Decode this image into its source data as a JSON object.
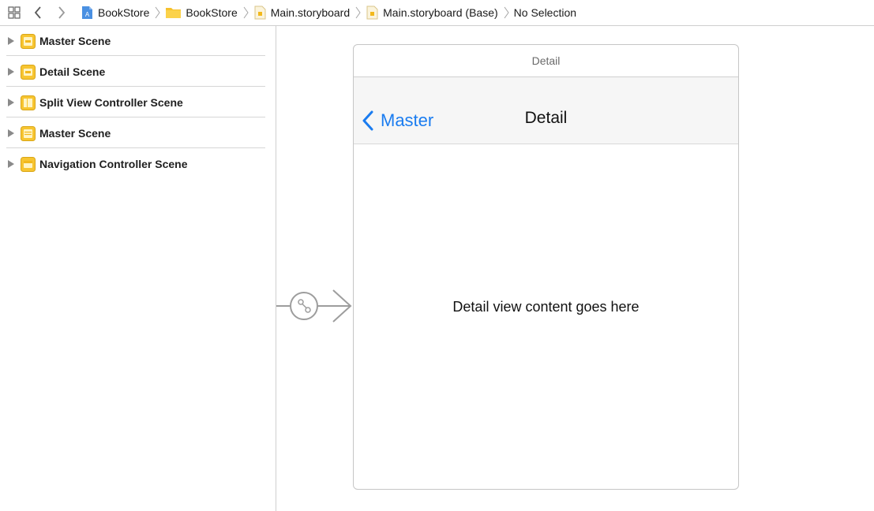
{
  "toolbar": {
    "icons": [
      "grid-icon",
      "back-arrow-icon",
      "forward-arrow-icon"
    ]
  },
  "breadcrumb": [
    {
      "label": "BookStore",
      "icon": "project-icon"
    },
    {
      "label": "BookStore",
      "icon": "folder-icon"
    },
    {
      "label": "Main.storyboard",
      "icon": "storyboard-file-icon"
    },
    {
      "label": "Main.storyboard (Base)",
      "icon": "storyboard-file-icon"
    },
    {
      "label": "No Selection",
      "icon": ""
    }
  ],
  "outline": {
    "scenes": [
      {
        "label": "Master Scene",
        "icon": "table-view-controller-icon"
      },
      {
        "label": "Detail Scene",
        "icon": "view-controller-icon"
      },
      {
        "label": "Split View Controller Scene",
        "icon": "split-view-controller-icon"
      },
      {
        "label": "Master Scene",
        "icon": "table-view-controller-icon"
      },
      {
        "label": "Navigation Controller Scene",
        "icon": "navigation-controller-icon"
      }
    ]
  },
  "canvas": {
    "scene_title": "Detail",
    "nav_back_label": "Master",
    "nav_title": "Detail",
    "content_label": "Detail view content goes here"
  },
  "colors": {
    "accent": "#1a7cf0",
    "scene_icon": "#f7c531",
    "divider": "#cfcfcf"
  }
}
